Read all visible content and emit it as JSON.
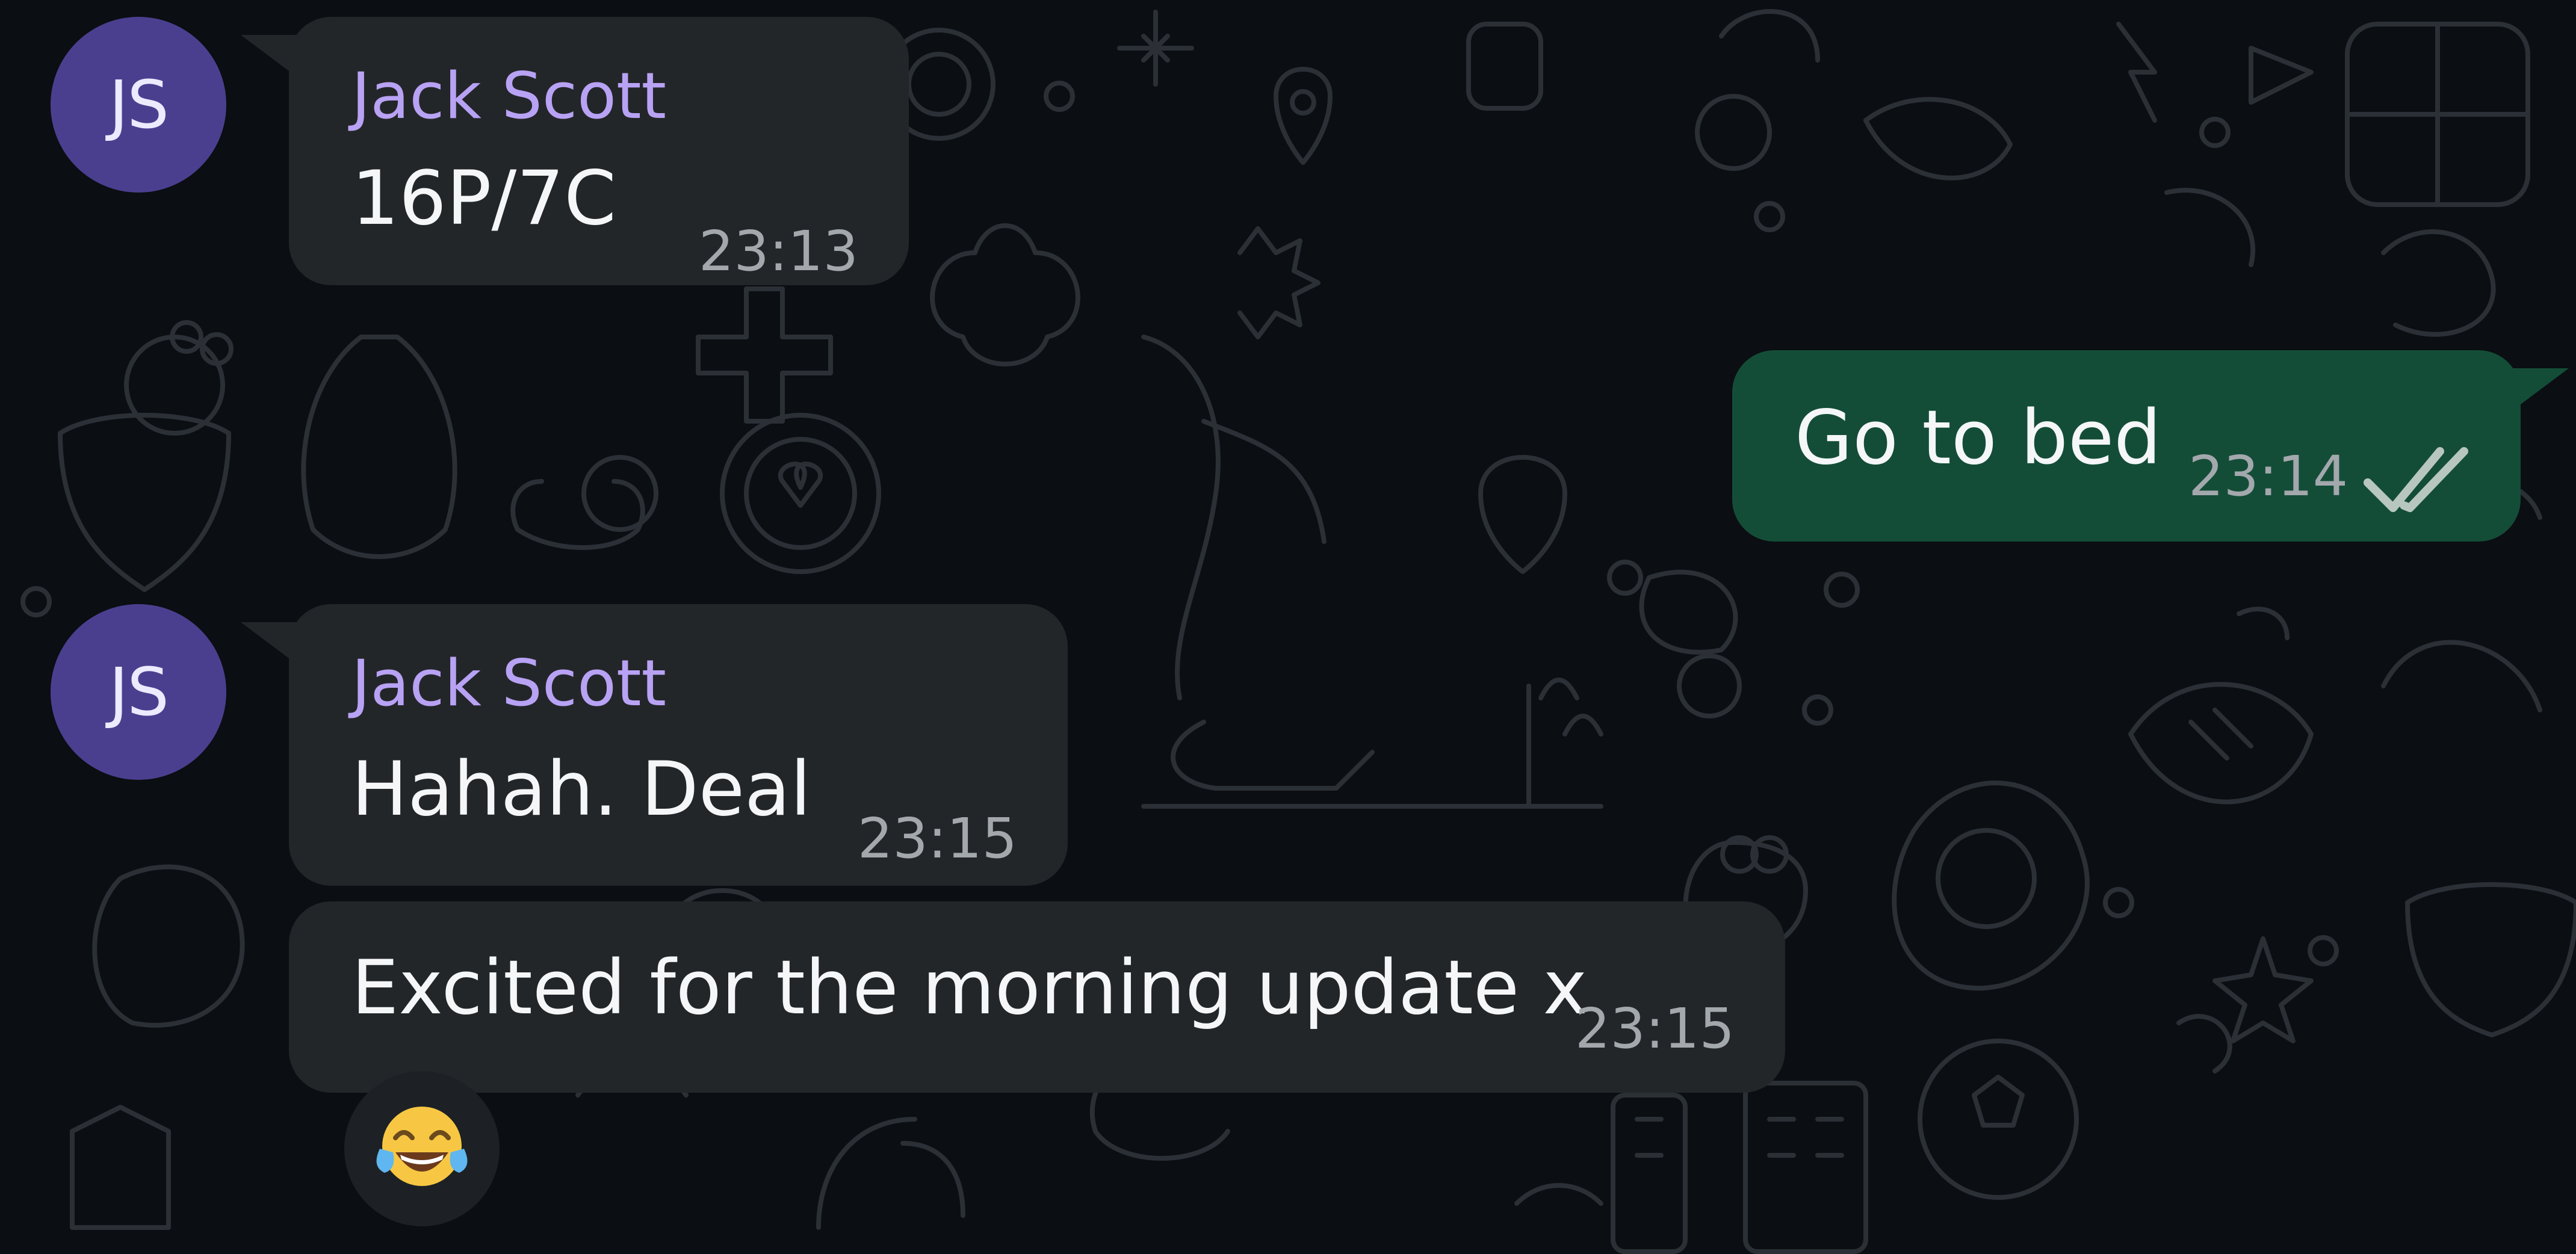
{
  "messages": [
    {
      "sender": "Jack Scott",
      "avatar_initials": "JS",
      "text": "16P/7C",
      "time": "23:13",
      "direction": "incoming"
    },
    {
      "text": "Go to bed",
      "time": "23:14",
      "direction": "outgoing",
      "status": "read"
    },
    {
      "sender": "Jack Scott",
      "avatar_initials": "JS",
      "text": "Hahah. Deal",
      "time": "23:15",
      "direction": "incoming"
    },
    {
      "text": "Excited for the morning update x",
      "time": "23:15",
      "direction": "incoming",
      "reaction": "face-with-tears-of-joy"
    }
  ],
  "icons": {
    "read_status": "double-check-icon",
    "reaction": "face-with-tears-of-joy-icon"
  },
  "colors": {
    "background": "#0b0e12",
    "incoming_bubble": "#232629",
    "outgoing_bubble": "#144d37",
    "sender_name": "#b8a2f4",
    "avatar": "#4a3f8f",
    "timestamp": "#a3a8ad"
  }
}
